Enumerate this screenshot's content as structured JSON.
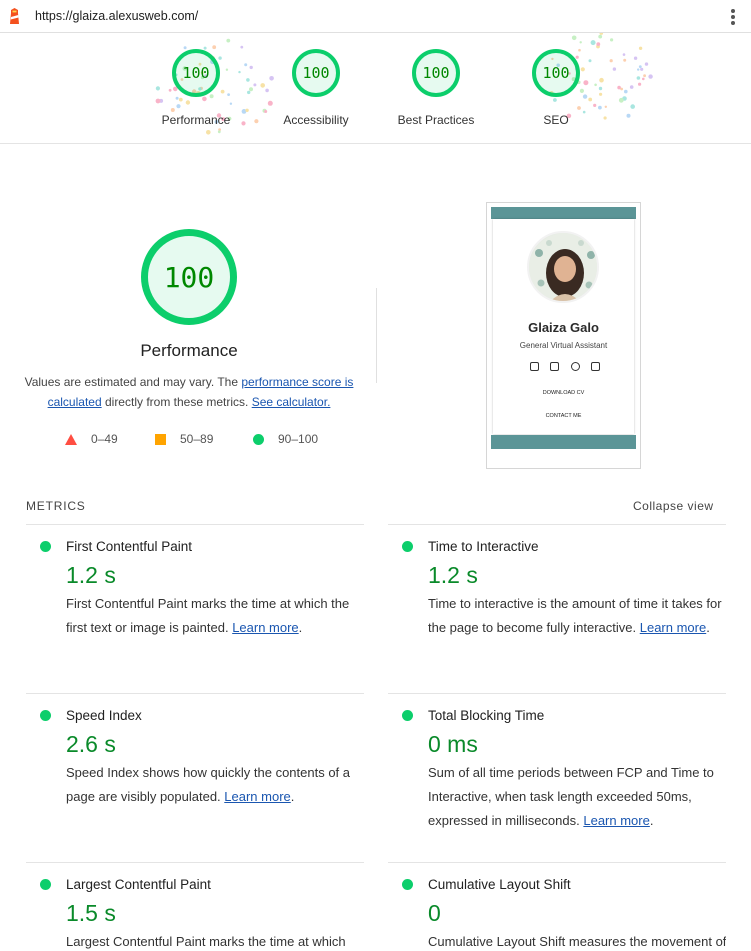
{
  "header": {
    "url": "https://glaiza.alexusweb.com/"
  },
  "summary": {
    "categories": [
      {
        "score": "100",
        "label": "Performance"
      },
      {
        "score": "100",
        "label": "Accessibility"
      },
      {
        "score": "100",
        "label": "Best Practices"
      },
      {
        "score": "100",
        "label": "SEO"
      }
    ]
  },
  "performance": {
    "score": "100",
    "title": "Performance",
    "desc_text_1": "Values are estimated and may vary. The ",
    "desc_link_1": "performance score is calculated",
    "desc_text_2": " directly from these metrics. ",
    "desc_link_2": "See calculator."
  },
  "legend": {
    "fail": "0–49",
    "average": "50–89",
    "pass": "90–100"
  },
  "screenshot": {
    "name": "Glaiza Galo",
    "role": "General Virtual Assistant",
    "download": "DOWNLOAD CV",
    "contact": "CONTACT ME"
  },
  "metrics": {
    "heading": "METRICS",
    "collapse_label": "Collapse view",
    "learn_more": "Learn more",
    "items": [
      {
        "title": "First Contentful Paint",
        "value": "1.2 s",
        "desc": "First Contentful Paint marks the time at which the first text or image is painted. "
      },
      {
        "title": "Time to Interactive",
        "value": "1.2 s",
        "desc": "Time to interactive is the amount of time it takes for the page to become fully interactive. "
      },
      {
        "title": "Speed Index",
        "value": "2.6 s",
        "desc": "Speed Index shows how quickly the contents of a page are visibly populated. "
      },
      {
        "title": "Total Blocking Time",
        "value": "0 ms",
        "desc": "Sum of all time periods between FCP and Time to Interactive, when task length exceeded 50ms, expressed in milliseconds. "
      },
      {
        "title": "Largest Contentful Paint",
        "value": "1.5 s",
        "desc": "Largest Contentful Paint marks the time at which the largest text or image is painted. "
      },
      {
        "title": "Cumulative Layout Shift",
        "value": "0",
        "desc": "Cumulative Layout Shift measures the movement of visible elements within the viewport. "
      }
    ]
  },
  "colors": {
    "pass": "#0cce6b",
    "pass_text": "#008800",
    "average": "#ffa400",
    "fail": "#ff4e42",
    "link": "#1a56b0",
    "thumb_band": "#5b9597"
  },
  "icons": {
    "lighthouse": "lighthouse-icon",
    "menu": "kebab-menu-icon"
  }
}
